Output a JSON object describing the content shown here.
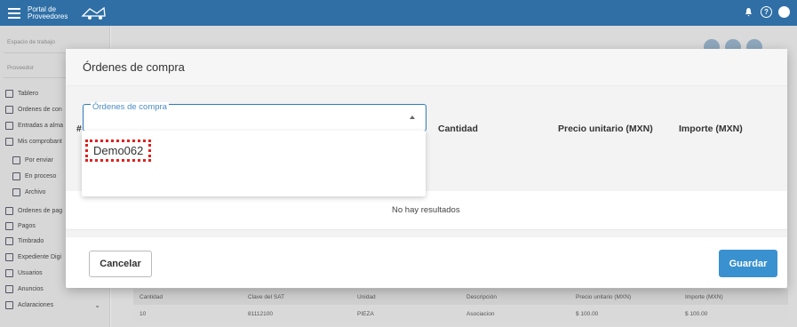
{
  "topbar": {
    "brand_line1": "Portal de",
    "brand_line2": "Proveedores",
    "icons": [
      "menu-icon",
      "bell-icon",
      "help-icon",
      "user-avatar-icon"
    ]
  },
  "sidebar": {
    "workspace_label": "Espacio de trabajo",
    "provider_label": "Proveedor",
    "items": [
      {
        "label": "Tablero",
        "icon": "dashboard-icon"
      },
      {
        "label": "Órdenes de con",
        "icon": "purchase-orders-icon"
      },
      {
        "label": "Entradas a alma",
        "icon": "truck-icon"
      },
      {
        "label": "Mis comprobant",
        "icon": "document-icon"
      },
      {
        "label": "Por enviar",
        "icon": "send-icon",
        "sub": true
      },
      {
        "label": "En proceso",
        "icon": "pending-icon",
        "sub": true
      },
      {
        "label": "Archivo",
        "icon": "archive-icon",
        "sub": true
      },
      {
        "label": "Órdenes de pag",
        "icon": "payment-orders-icon"
      },
      {
        "label": "Pagos",
        "icon": "payments-icon"
      },
      {
        "label": "Timbrado",
        "icon": "stamp-icon"
      },
      {
        "label": "Expediente Digi",
        "icon": "folder-icon"
      },
      {
        "label": "Usuarios",
        "icon": "users-icon"
      },
      {
        "label": "Anuncios",
        "icon": "announcement-icon"
      },
      {
        "label": "Aclaraciones",
        "icon": "clarifications-icon"
      }
    ]
  },
  "background_table": {
    "headers": [
      "Cantidad",
      "Clave del SAT",
      "Unidad",
      "Descripción",
      "Precio unitario (MXN)",
      "Importe (MXN)"
    ],
    "rows": [
      [
        "10",
        "81112100",
        "PIEZA",
        "Asociacion",
        "$ 100.00",
        "$ 100.00"
      ]
    ]
  },
  "modal": {
    "title": "Órdenes de compra",
    "select": {
      "label": "Órdenes de compra",
      "value": ""
    },
    "dropdown_options": [
      "Demo062"
    ],
    "table": {
      "hash": "#",
      "headers": [
        "Cantidad",
        "Precio unitario (MXN)",
        "Importe (MXN)"
      ],
      "empty_text": "No hay resultados"
    },
    "cancel_label": "Cancelar",
    "save_label": "Guardar"
  },
  "colors": {
    "topbar": "#2f6fa6",
    "primary_button": "#3a91cf",
    "highlight_border": "#e02020"
  }
}
